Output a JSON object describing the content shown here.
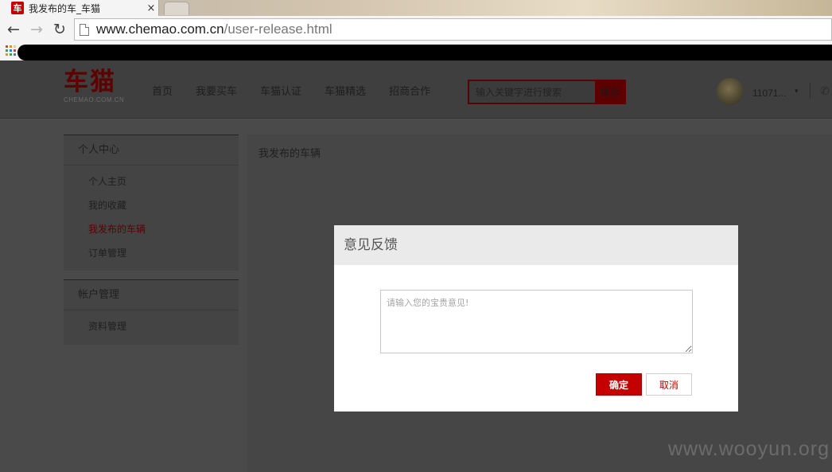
{
  "browser": {
    "tab_title": "我发布的车_车猫",
    "tab_favicon": "车",
    "tab_close": "×",
    "back_icon": "←",
    "forward_icon": "→",
    "reload_icon": "↻",
    "url_host": "www.chemao.com.cn",
    "url_path": "/user-release.html"
  },
  "header": {
    "logo_cn": "车猫",
    "logo_en": "CHEMAO.COM.CN",
    "nav": [
      "首页",
      "我要买车",
      "车猫认证",
      "车猫精选",
      "招商合作"
    ],
    "search_placeholder": "输入关键字进行搜索",
    "search_button": "搜索",
    "username": "11071...",
    "user_caret": "▾",
    "phone_icon": "✆"
  },
  "sidebar": {
    "sections": [
      {
        "title": "个人中心",
        "items": [
          {
            "label": "个人主页",
            "active": false
          },
          {
            "label": "我的收藏",
            "active": false
          },
          {
            "label": "我发布的车辆",
            "active": true
          },
          {
            "label": "订单管理",
            "active": false
          }
        ]
      },
      {
        "title": "帐户管理",
        "items": [
          {
            "label": "资料管理",
            "active": false
          }
        ]
      }
    ]
  },
  "content": {
    "title": "我发布的车辆"
  },
  "modal": {
    "title": "意见反馈",
    "textarea_placeholder": "请输入您的宝贵意见!",
    "ok_label": "确定",
    "cancel_label": "取消"
  },
  "watermark": "www.wooyun.org",
  "colors": {
    "brand_red": "#c40000",
    "overlay_brand": "#5c0000",
    "overlay_bg": "#4a4a4a"
  }
}
